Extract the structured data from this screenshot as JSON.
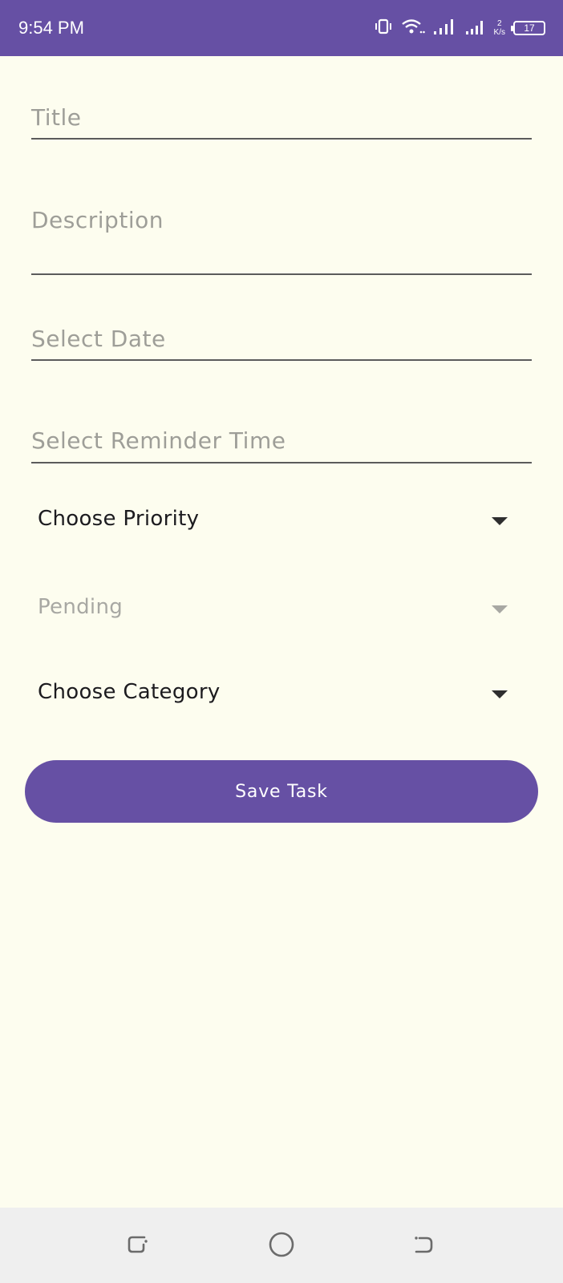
{
  "status_bar": {
    "time": "9:54 PM",
    "net_speed_value": "2",
    "net_speed_unit": "K/s",
    "battery_level": "17",
    "background_color": "#6650A4",
    "icons": [
      "vibrate-icon",
      "wifi-icon",
      "signal-icon",
      "signal-icon",
      "battery-icon"
    ]
  },
  "form": {
    "title_placeholder": "Title",
    "description_placeholder": "Description",
    "date_placeholder": "Select Date",
    "reminder_placeholder": "Select Reminder Time",
    "priority_value": "Choose Priority",
    "status_value": "Pending",
    "category_value": "Choose Category",
    "save_label": "Save Task"
  },
  "nav_bar": {
    "icons": [
      "recents-icon",
      "home-icon",
      "back-icon"
    ]
  },
  "colors": {
    "accent": "#6650A4",
    "background": "#FDFDEF",
    "placeholder": "#9E9E98",
    "text": "#1C1B1F",
    "disabled": "#A8A8A3"
  }
}
